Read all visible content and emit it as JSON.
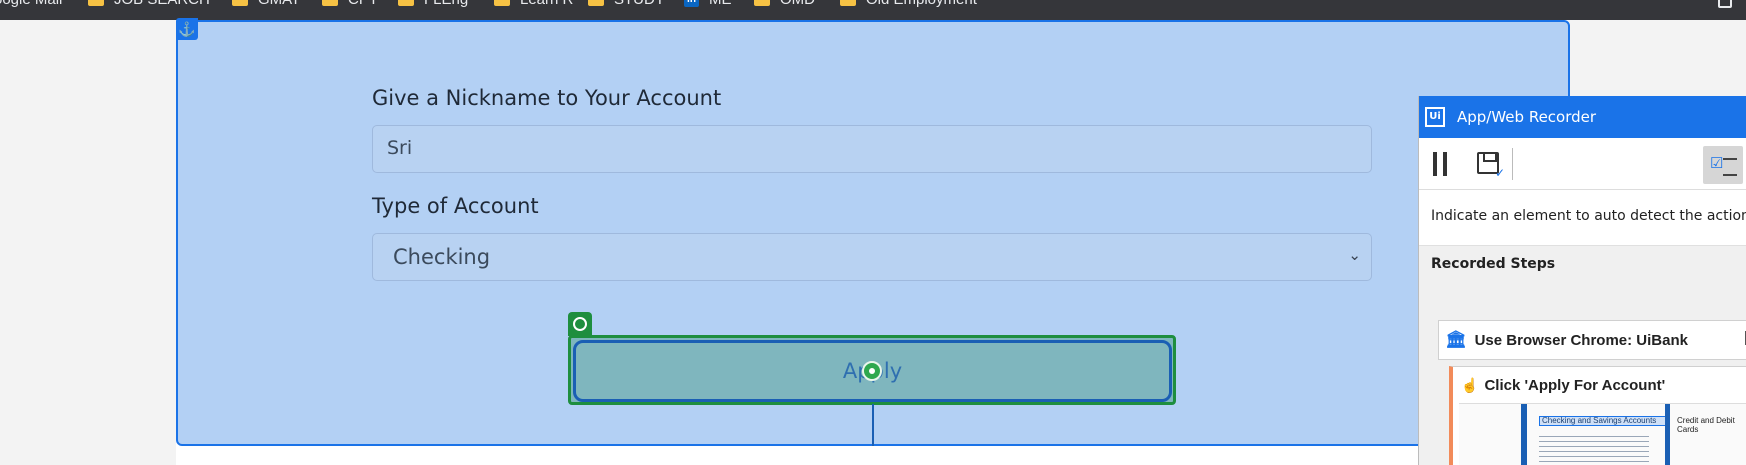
{
  "bookmarks": [
    {
      "label": "oogle Mail",
      "icon": "folder-icon"
    },
    {
      "label": "JOB SEARCH",
      "icon": "folder-icon"
    },
    {
      "label": "GMAT",
      "icon": "folder-icon"
    },
    {
      "label": "CPT",
      "icon": "folder-icon"
    },
    {
      "label": "FLEng",
      "icon": "folder-icon"
    },
    {
      "label": "Learn R",
      "icon": "folder-icon"
    },
    {
      "label": "STUDY",
      "icon": "folder-icon"
    },
    {
      "label": "ME",
      "icon": "linkedin-icon"
    },
    {
      "label": "OMD",
      "icon": "folder-icon"
    },
    {
      "label": "Old Employment",
      "icon": "folder-icon"
    }
  ],
  "form": {
    "nickname_label": "Give a Nickname to Your Account",
    "nickname_value": "Sri",
    "type_label": "Type of Account",
    "type_value": "Checking",
    "apply_label": "Apply"
  },
  "recorder": {
    "title": "App/Web Recorder",
    "hint": "Indicate an element to auto detect the action",
    "steps_label": "Recorded Steps",
    "steps": [
      {
        "label": "Use Browser Chrome: UiBank"
      },
      {
        "label": "Click 'Apply For Account'"
      }
    ],
    "thumbnail": {
      "highlight_text": "Checking and Savings Accounts",
      "side_text": "Credit and Debit Cards"
    }
  },
  "colors": {
    "anchor_highlight": "#1a73e8",
    "target_highlight": "#1e8e3e",
    "recorder_header": "#1a73e8"
  }
}
